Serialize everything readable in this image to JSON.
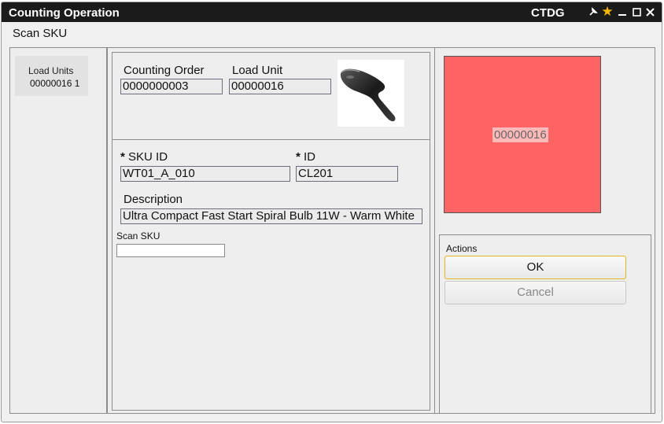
{
  "window": {
    "title": "Counting Operation",
    "app_code": "CTDG",
    "icons": [
      "pin-icon",
      "star-icon",
      "minimize-icon",
      "maximize-icon",
      "close-icon"
    ],
    "accent_colors": {
      "titlebar": "#1b1b1b",
      "star": "#f5b800",
      "load_unit_tile": "#ff6464",
      "ok_border": "#e0b422"
    }
  },
  "subtitle": "Scan SKU",
  "sidebar": {
    "header": "Load Units",
    "items": [
      {
        "code": "00000016",
        "count": "1"
      }
    ]
  },
  "order": {
    "counting_order_label": "Counting Order",
    "counting_order_value": "0000000003",
    "load_unit_label": "Load Unit",
    "load_unit_value": "00000016",
    "image": "barcode-scanner-image"
  },
  "sku": {
    "sku_id_label": "SKU ID",
    "sku_id_value": "WT01_A_010",
    "id_label": "ID",
    "id_value": "CL201",
    "required_marker": "*",
    "description_label": "Description",
    "description_value": "Ultra Compact Fast Start Spiral Bulb 11W - Warm White",
    "scan_label": "Scan SKU",
    "scan_value": ""
  },
  "load_unit_tile": {
    "code": "00000016"
  },
  "actions": {
    "header": "Actions",
    "ok_label": "OK",
    "cancel_label": "Cancel"
  }
}
